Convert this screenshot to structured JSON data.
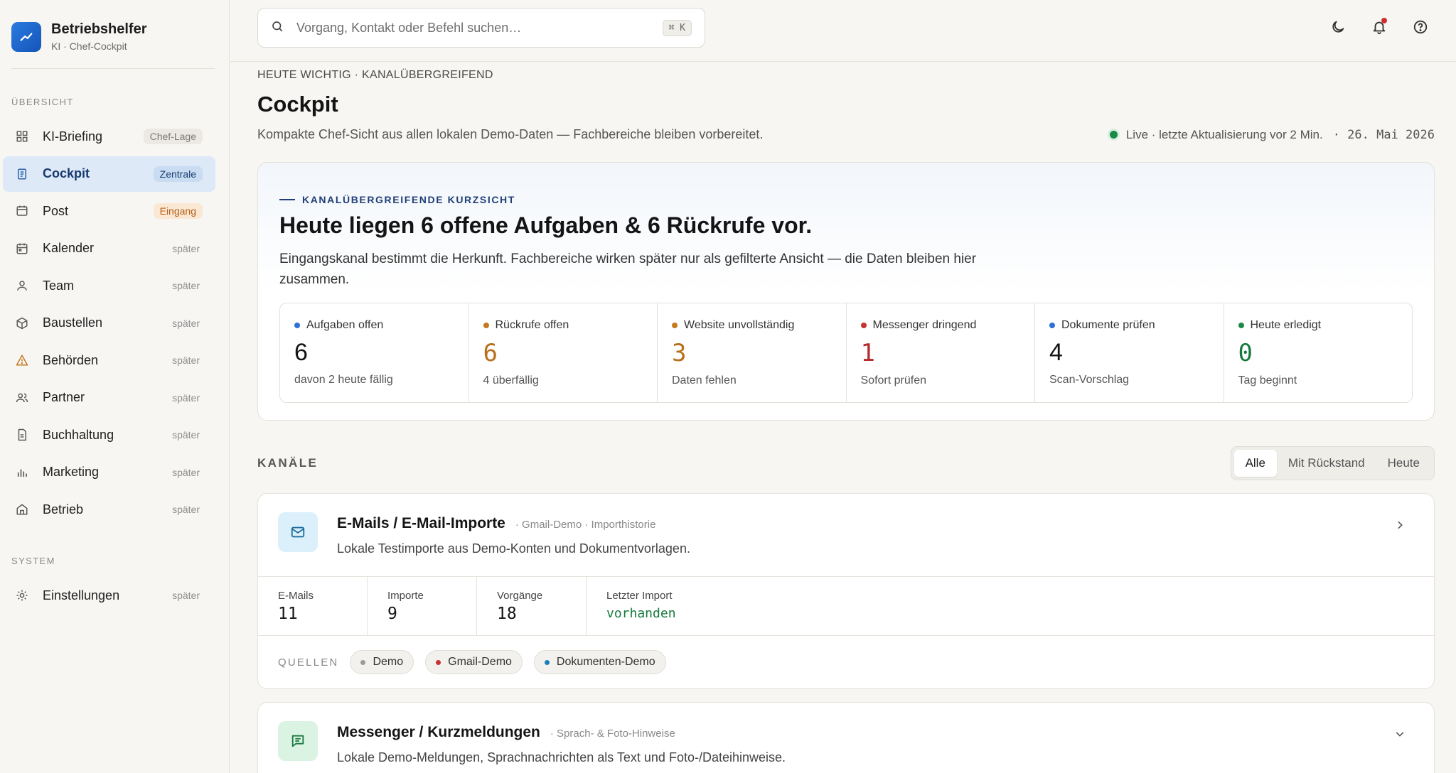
{
  "brand": {
    "title": "Betriebshelfer",
    "subtitle": "KI · Chef-Cockpit"
  },
  "sidebar": {
    "section_overview": "ÜBERSICHT",
    "items": [
      {
        "label": "KI-Briefing",
        "badge": "Chef-Lage",
        "icon": "grid-icon"
      },
      {
        "label": "Cockpit",
        "badge": "Zentrale",
        "icon": "document-icon"
      },
      {
        "label": "Post",
        "badge": "Eingang",
        "icon": "inbox-icon"
      },
      {
        "label": "Kalender",
        "badge": "später",
        "icon": "calendar-icon"
      },
      {
        "label": "Team",
        "badge": "später",
        "icon": "user-icon"
      },
      {
        "label": "Baustellen",
        "badge": "später",
        "icon": "box-icon"
      },
      {
        "label": "Behörden",
        "badge": "später",
        "icon": "warning-icon"
      },
      {
        "label": "Partner",
        "badge": "später",
        "icon": "users-icon"
      },
      {
        "label": "Buchhaltung",
        "badge": "später",
        "icon": "receipt-icon"
      },
      {
        "label": "Marketing",
        "badge": "später",
        "icon": "bar-chart-icon"
      },
      {
        "label": "Betrieb",
        "badge": "später",
        "icon": "building-icon"
      }
    ],
    "section_system": "SYSTEM",
    "system_items": [
      {
        "label": "Einstellungen",
        "badge": "später",
        "icon": "gear-icon"
      }
    ]
  },
  "search": {
    "placeholder": "Vorgang, Kontakt oder Befehl suchen…",
    "shortcut": "⌘ K"
  },
  "header": {
    "eyebrow": "HEUTE WICHTIG · KANALÜBERGREIFEND",
    "title": "Cockpit",
    "subtitle": "Kompakte Chef-Sicht aus allen lokalen Demo-Daten — Fachbereiche bleiben vorbereitet.",
    "live": "Live · letzte Aktualisierung vor 2 Min.",
    "date": "· 26. Mai 2026"
  },
  "hero": {
    "eyebrow": "KANALÜBERGREIFENDE KURZSICHT",
    "title": "Heute liegen 6 offene Aufgaben & 6 Rückrufe vor.",
    "text": "Eingangskanal bestimmt die Herkunft. Fachbereiche wirken später nur als gefilterte Ansicht — die Daten bleiben hier zusammen.",
    "stats": [
      {
        "label": "Aufgaben offen",
        "value": "6",
        "sub": "davon 2 heute fällig",
        "dot": "#2f6fd6",
        "color": "#141414"
      },
      {
        "label": "Rückrufe offen",
        "value": "6",
        "sub": "4 überfällig",
        "dot": "#c5781f",
        "color": "#b86e1a"
      },
      {
        "label": "Website unvollständig",
        "value": "3",
        "sub": "Daten fehlen",
        "dot": "#c5781f",
        "color": "#b86e1a"
      },
      {
        "label": "Messenger dringend",
        "value": "1",
        "sub": "Sofort prüfen",
        "dot": "#c83232",
        "color": "#b52a2a"
      },
      {
        "label": "Dokumente prüfen",
        "value": "4",
        "sub": "Scan-Vorschlag",
        "dot": "#2f6fd6",
        "color": "#141414"
      },
      {
        "label": "Heute erledigt",
        "value": "0",
        "sub": "Tag beginnt",
        "dot": "#1b8a47",
        "color": "#157a3c"
      }
    ]
  },
  "channels": {
    "title": "KANÄLE",
    "filters": [
      "Alle",
      "Mit Rückstand",
      "Heute"
    ],
    "email": {
      "title": "E-Mails / E-Mail-Importe",
      "meta": "· Gmail-Demo · Importhistorie",
      "desc": "Lokale Testimporte aus Demo-Konten und Dokumentvorlagen.",
      "metrics": [
        {
          "label": "E-Mails",
          "value": "11"
        },
        {
          "label": "Importe",
          "value": "9"
        },
        {
          "label": "Vorgänge",
          "value": "18"
        },
        {
          "label": "Letzter Import",
          "value": "vorhanden"
        }
      ],
      "sources_label": "QUELLEN",
      "sources": [
        {
          "label": "Demo",
          "dot": "#9a9a9a"
        },
        {
          "label": "Gmail-Demo",
          "dot": "#c83232"
        },
        {
          "label": "Dokumenten-Demo",
          "dot": "#1a7fb8"
        }
      ]
    },
    "messenger": {
      "title": "Messenger / Kurzmeldungen",
      "meta": "· Sprach- & Foto-Hinweise",
      "desc": "Lokale Demo-Meldungen, Sprachnachrichten als Text und Foto-/Dateihinweise."
    }
  }
}
